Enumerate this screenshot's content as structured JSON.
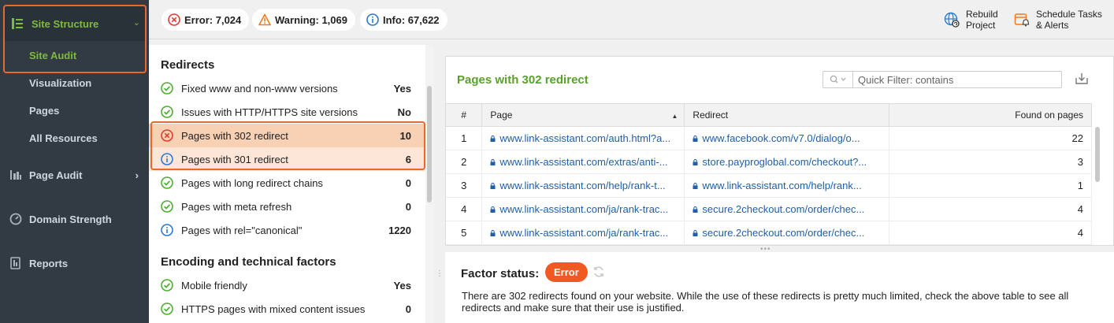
{
  "sidebar": {
    "section": "Site Structure",
    "sub_items": [
      "Site Audit",
      "Visualization",
      "Pages",
      "All Resources"
    ],
    "items": [
      "Page Audit",
      "Domain Strength",
      "Reports"
    ]
  },
  "topbar": {
    "error": "Error: 7,024",
    "warning": "Warning: 1,069",
    "info": "Info: 67,622",
    "rebuild": [
      "Rebuild",
      "Project"
    ],
    "schedule": [
      "Schedule Tasks",
      "& Alerts"
    ]
  },
  "issues": {
    "section1": "Redirects",
    "rows1": [
      {
        "status": "ok",
        "label": "Fixed www and non-www versions",
        "value": "Yes"
      },
      {
        "status": "ok",
        "label": "Issues with HTTP/HTTPS site versions",
        "value": "No"
      },
      {
        "status": "error",
        "label": "Pages with 302 redirect",
        "value": "10"
      },
      {
        "status": "info",
        "label": "Pages with 301 redirect",
        "value": "6"
      },
      {
        "status": "ok",
        "label": "Pages with long redirect chains",
        "value": "0"
      },
      {
        "status": "ok",
        "label": "Pages with meta refresh",
        "value": "0"
      },
      {
        "status": "info",
        "label": "Pages with rel=\"canonical\"",
        "value": "1220"
      }
    ],
    "section2": "Encoding and technical factors",
    "rows2": [
      {
        "status": "ok",
        "label": "Mobile friendly",
        "value": "Yes"
      },
      {
        "status": "ok",
        "label": "HTTPS pages with mixed content issues",
        "value": "0"
      }
    ]
  },
  "detail": {
    "title": "Pages with 302 redirect",
    "filter_placeholder": "Quick Filter: contains",
    "columns": [
      "#",
      "Page",
      "Redirect",
      "Found on pages"
    ],
    "rows": [
      {
        "n": "1",
        "page": "www.link-assistant.com/auth.html?a...",
        "redirect": "www.facebook.com/v7.0/dialog/o...",
        "found": "22"
      },
      {
        "n": "2",
        "page": "www.link-assistant.com/extras/anti-...",
        "redirect": "store.payproglobal.com/checkout?...",
        "found": "3"
      },
      {
        "n": "3",
        "page": "www.link-assistant.com/help/rank-t...",
        "redirect": "www.link-assistant.com/help/rank...",
        "found": "1"
      },
      {
        "n": "4",
        "page": "www.link-assistant.com/ja/rank-trac...",
        "redirect": "secure.2checkout.com/order/chec...",
        "found": "4"
      },
      {
        "n": "5",
        "page": "www.link-assistant.com/ja/rank-trac...",
        "redirect": "secure.2checkout.com/order/chec...",
        "found": "4"
      }
    ]
  },
  "factor": {
    "label": "Factor status:",
    "badge": "Error",
    "description": "There are 302 redirects found on your website. While the use of these redirects is pretty much limited, check the above table to see all redirects and make sure that their use is justified."
  },
  "colors": {
    "accent_green": "#7dbb3c",
    "selection_border": "#e8692c",
    "error_red": "#e03b2f",
    "info_blue": "#2b78d4",
    "ok_green": "#4caf2e",
    "badge": "#f05a22"
  }
}
